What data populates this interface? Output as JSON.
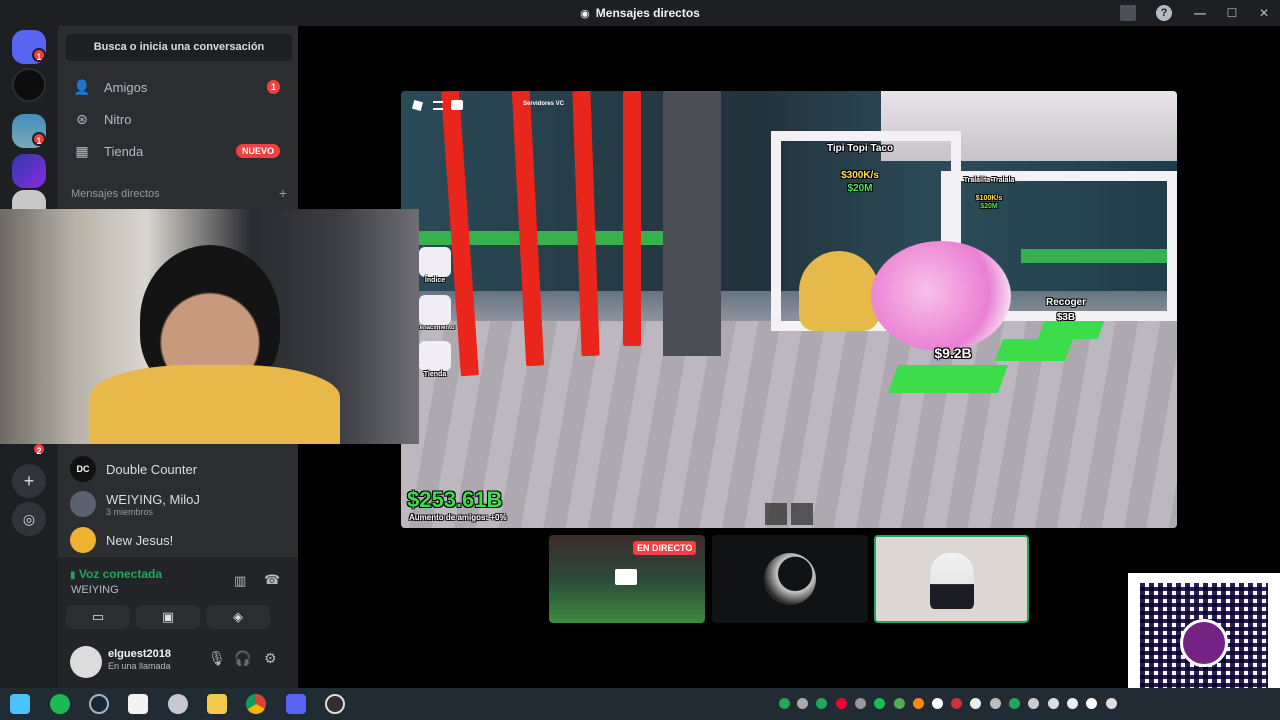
{
  "window": {
    "title": "Mensajes directos"
  },
  "guilds": {
    "home_badge": "1",
    "server_badge": "1",
    "lower_badge": "2"
  },
  "sidebar": {
    "search_placeholder": "Busca o inicia una conversación",
    "nav": [
      {
        "label": "Amigos",
        "badge": "1"
      },
      {
        "label": "Nitro"
      },
      {
        "label": "Tienda",
        "badge": "NUEVO"
      }
    ],
    "dm_header": "Mensajes directos",
    "dm_add": "+",
    "dms": [
      {
        "name": "Double Counter"
      },
      {
        "name": "WEIYING, MiloJ",
        "sub": "3 miembros"
      },
      {
        "name": "New Jesus!"
      }
    ]
  },
  "voice": {
    "status": "Voz conectada",
    "channel": "WEIYING"
  },
  "user": {
    "name": "elguest2018",
    "status": "En una llamada"
  },
  "game": {
    "pets": [
      {
        "name": "Tipi Topi Taco",
        "rate": "$300K/s",
        "price": "$20M"
      },
      {
        "name": "Tralalita Tralala",
        "rate": "$100K/s",
        "price": "$20M"
      }
    ],
    "pad_value": "$9.2B",
    "collect_label": "Recoger",
    "collect_value": "$3B",
    "money": "$253.61B",
    "friends_boost": "Aumento de amigos: +0%",
    "side_buttons": [
      "Índice",
      "Renacimiento",
      "Tienda"
    ],
    "servers_label": "Servidores VC"
  },
  "stream": {
    "live_label": "EN DIRECTO"
  },
  "colors": {
    "accent": "#5865f2",
    "danger": "#f23f43",
    "online": "#23a55a",
    "money": "#3ddc4a"
  }
}
